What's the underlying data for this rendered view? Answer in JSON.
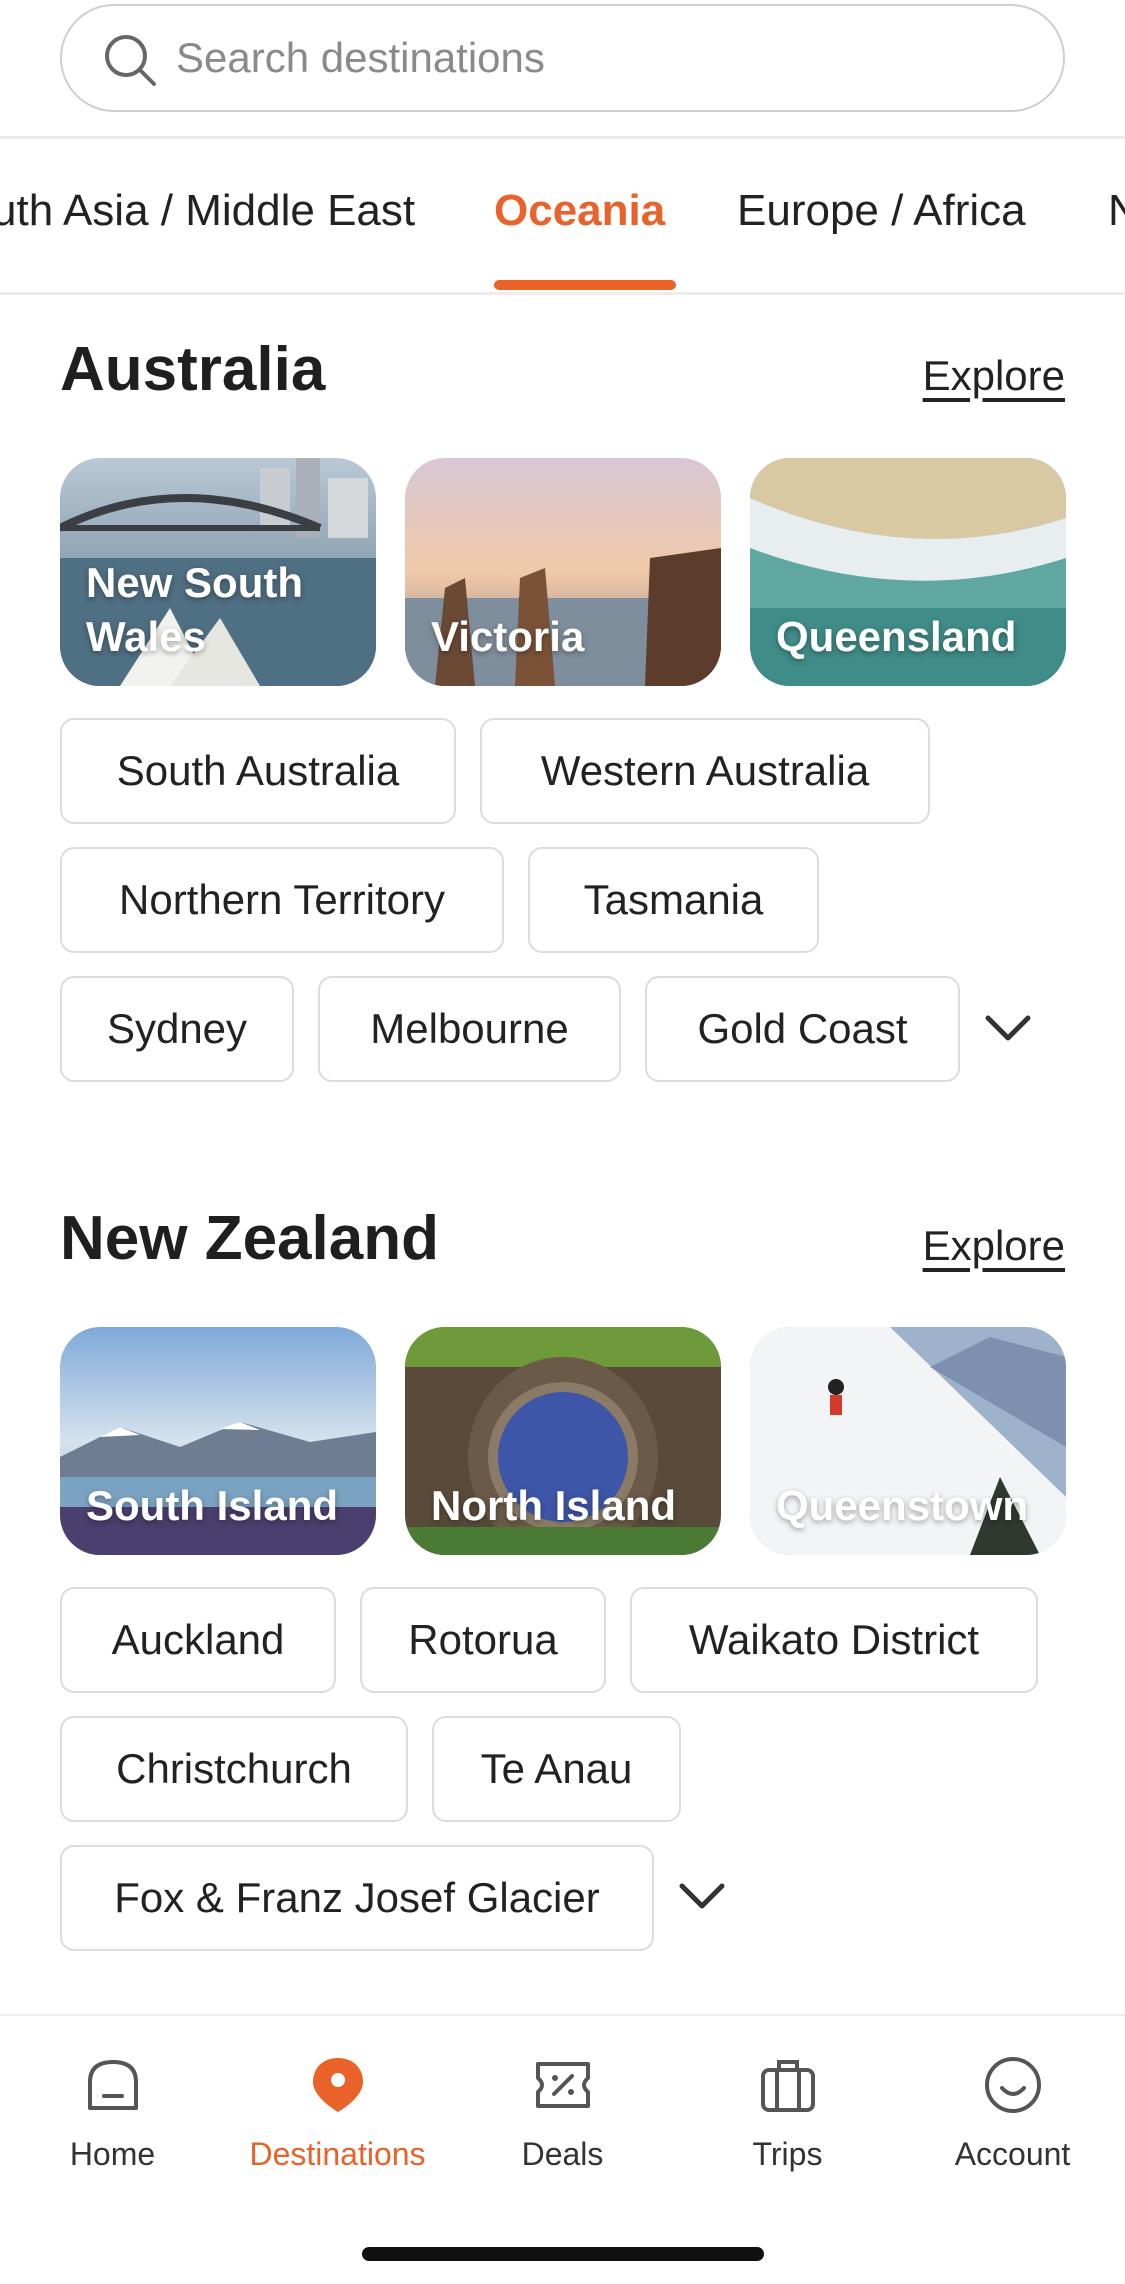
{
  "search": {
    "placeholder": "Search destinations",
    "icon": "search-icon"
  },
  "tabs": [
    {
      "label": "uth Asia / Middle East",
      "active": false
    },
    {
      "label": "Oceania",
      "active": true
    },
    {
      "label": "Europe / Africa",
      "active": false
    },
    {
      "label": "N",
      "active": false
    }
  ],
  "sections": [
    {
      "title": "Australia",
      "explore_label": "Explore",
      "cards": [
        {
          "label": "New South Wales"
        },
        {
          "label": "Victoria"
        },
        {
          "label": "Queensland"
        }
      ],
      "chips": [
        "South Australia",
        "Western Australia",
        "Northern Territory",
        "Tasmania",
        "Sydney",
        "Melbourne",
        "Gold Coast"
      ],
      "expand_icon": "chevron-down-icon"
    },
    {
      "title": "New Zealand",
      "explore_label": "Explore",
      "cards": [
        {
          "label": "South Island"
        },
        {
          "label": "North Island"
        },
        {
          "label": "Queenstown"
        }
      ],
      "chips": [
        "Auckland",
        "Rotorua",
        "Waikato District",
        "Christchurch",
        "Te Anau",
        "Fox & Franz Josef Glacier"
      ],
      "expand_icon": "chevron-down-icon"
    }
  ],
  "bottom_nav": [
    {
      "label": "Home",
      "icon": "home-icon",
      "active": false
    },
    {
      "label": "Destinations",
      "icon": "location-pin-icon",
      "active": true
    },
    {
      "label": "Deals",
      "icon": "deals-icon",
      "active": false
    },
    {
      "label": "Trips",
      "icon": "suitcase-icon",
      "active": false
    },
    {
      "label": "Account",
      "icon": "account-smile-icon",
      "active": false
    }
  ],
  "colors": {
    "accent": "#e8622a",
    "text": "#222222",
    "border": "#dcdcdc"
  }
}
